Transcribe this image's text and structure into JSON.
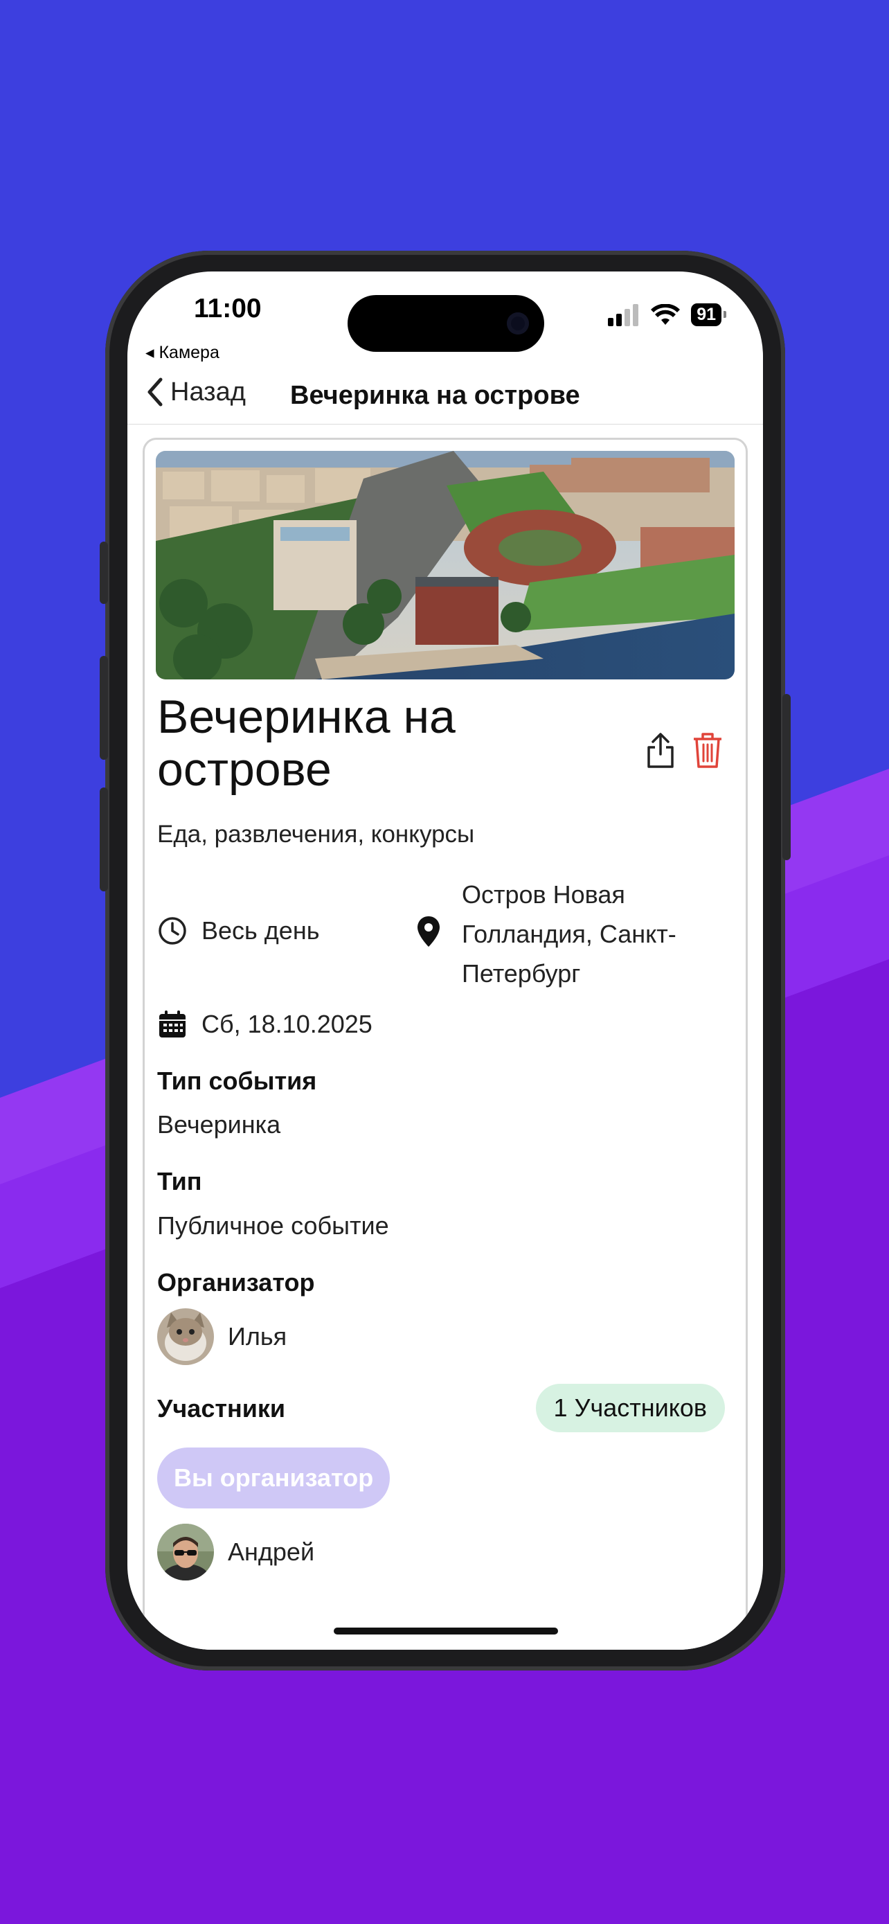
{
  "status": {
    "time": "11:00",
    "back_app": "◂ Камера",
    "battery": "91"
  },
  "nav": {
    "back_label": "Назад",
    "title": "Вечеринка на острове"
  },
  "event": {
    "title": "Вечеринка на острове",
    "description": "Еда, развлечения, конкурсы",
    "time": "Весь день",
    "location": "Остров Новая Голландия, Санкт-Петербург",
    "date": "Сб, 18.10.2025"
  },
  "details": {
    "event_type_label": "Тип события",
    "event_type_value": "Вечеринка",
    "type_label": "Тип",
    "type_value": "Публичное событие",
    "organizer_label": "Организатор",
    "organizer_name": "Илья",
    "participants_label": "Участники",
    "participants_count": "1 Участников",
    "organizer_badge": "Вы организатор",
    "participant_name": "Андрей"
  },
  "colors": {
    "accent": "#3d3fdf",
    "purple": "#7a17d8",
    "delete": "#e0443a",
    "count_pill": "#d7f2e2",
    "org_pill": "#cfc8f6"
  }
}
